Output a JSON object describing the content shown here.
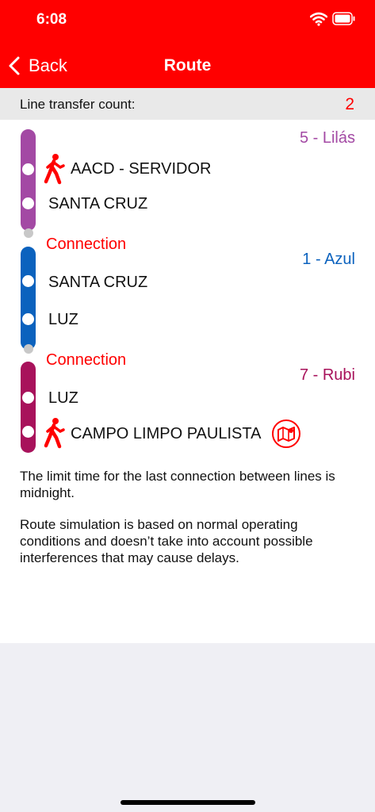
{
  "status_bar": {
    "time": "6:08"
  },
  "nav": {
    "back_label": "Back",
    "title": "Route"
  },
  "transfer": {
    "label": "Line transfer count:",
    "count": "2"
  },
  "lines": [
    {
      "name": "5 - Lilás",
      "color": "#a349a4",
      "stations": [
        "AACD - SERVIDOR",
        "SANTA CRUZ"
      ]
    },
    {
      "name": "1 - Azul",
      "color": "#0b62be",
      "stations": [
        "SANTA CRUZ",
        "LUZ"
      ]
    },
    {
      "name": "7 - Rubi",
      "color": "#a8125b",
      "stations": [
        "LUZ",
        "CAMPO LIMPO PAULISTA"
      ]
    }
  ],
  "connection_label": "Connection",
  "icons": [
    "walk-icon",
    "map-icon",
    "wifi-icon",
    "battery-icon",
    "chevron-left-icon"
  ],
  "notes": [
    "The limit time for the last connection between lines is midnight.",
    "Route simulation is based on normal operating conditions and doesn’t take into account possible interferences that may cause delays."
  ],
  "colors": {
    "accent": "#ff0000",
    "background": "#efeff4"
  }
}
